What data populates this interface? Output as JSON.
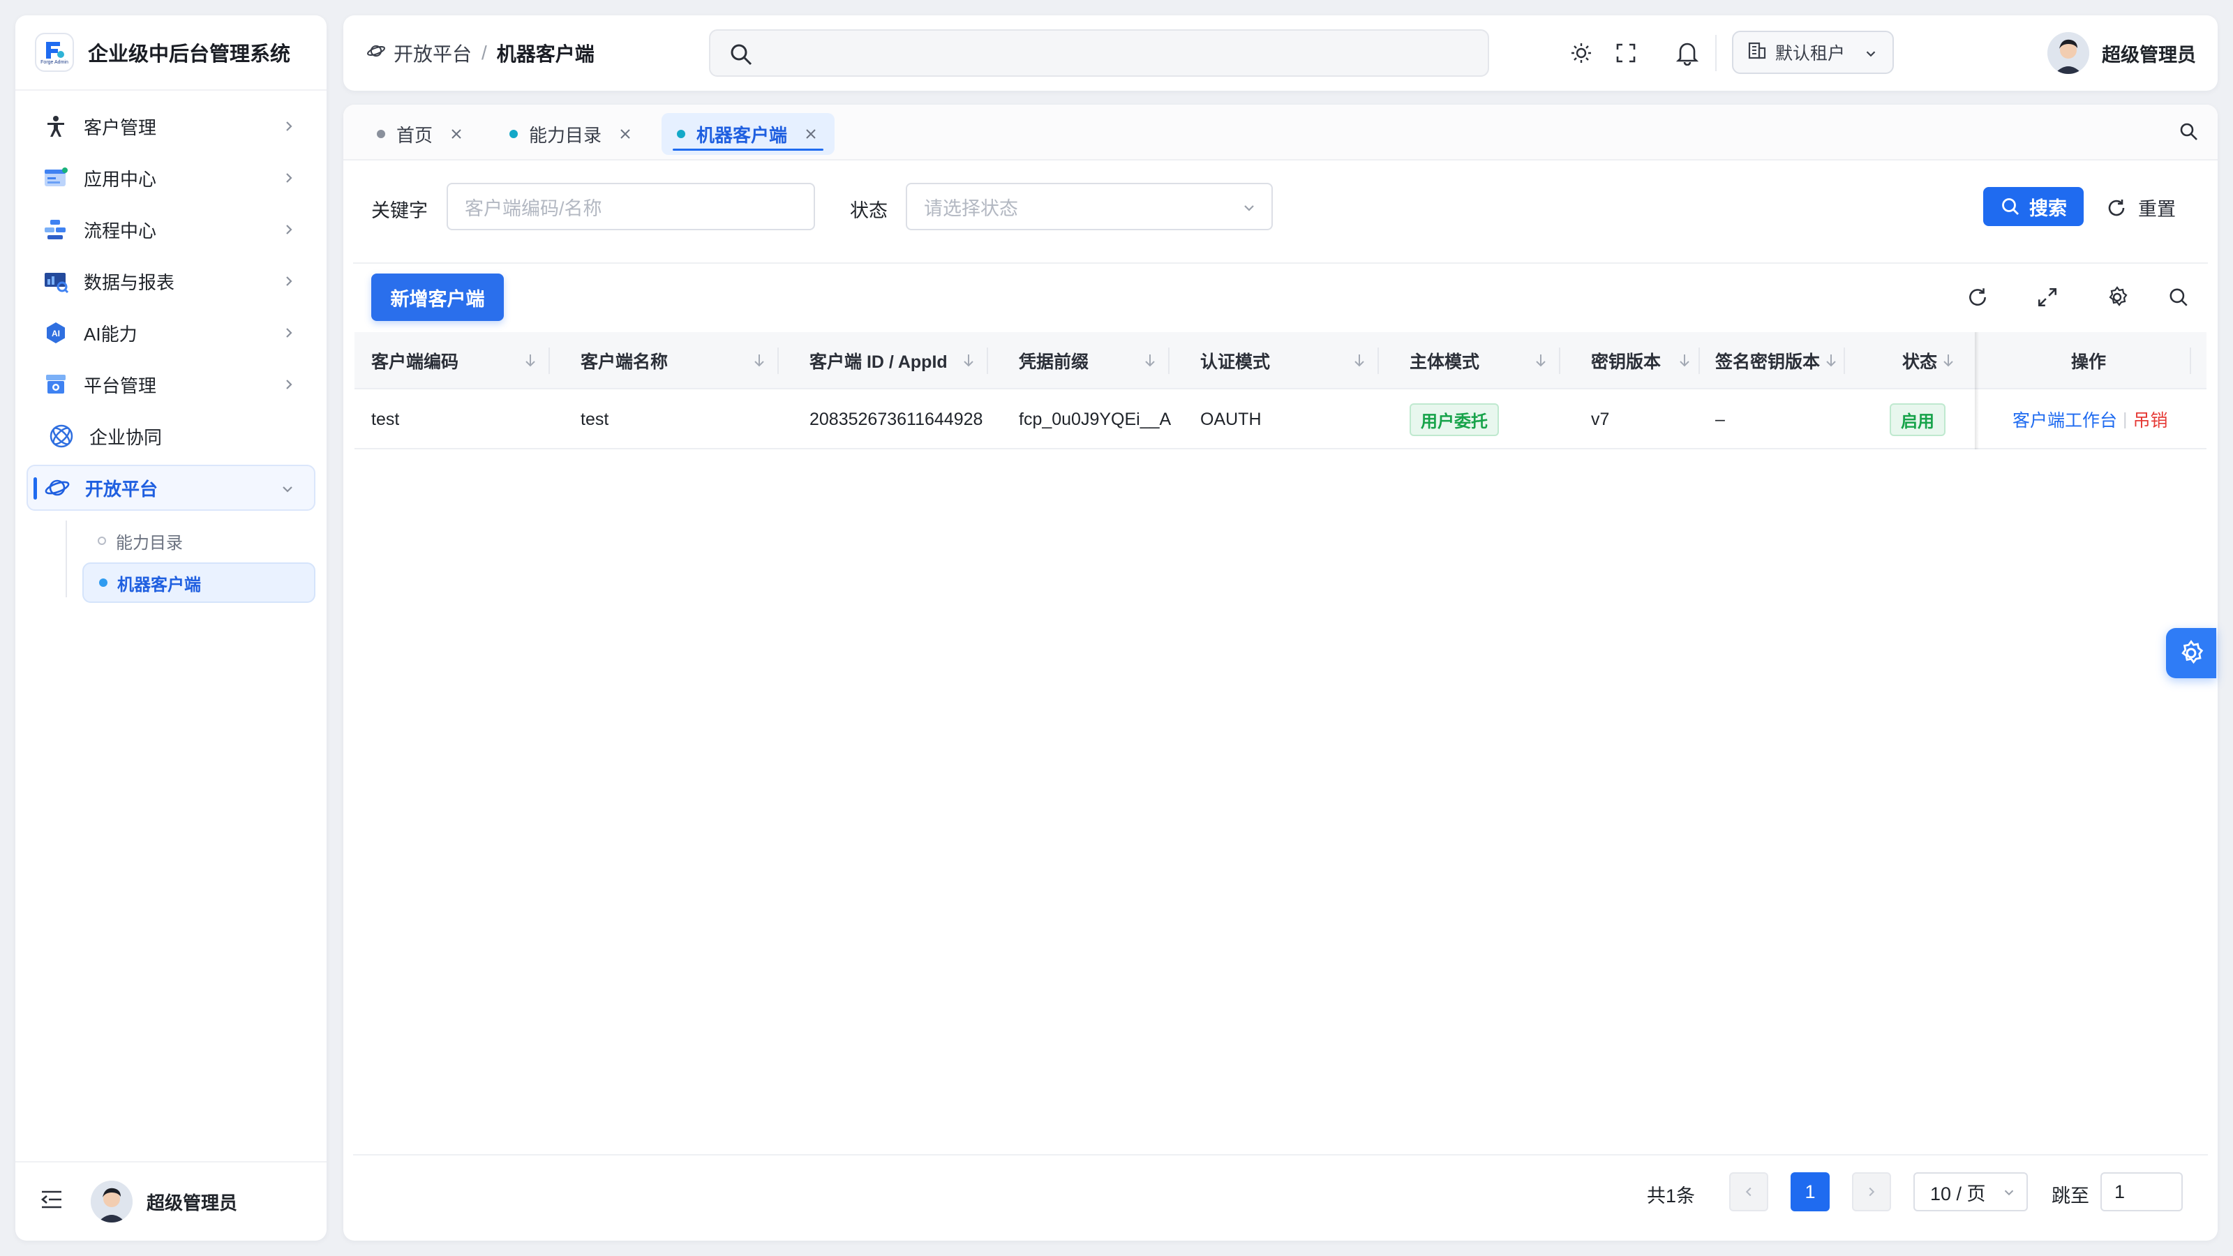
{
  "app": {
    "title": "企业级中后台管理系统",
    "logo_text": "Forge Admin"
  },
  "sidebar": {
    "items": [
      {
        "label": "客户管理",
        "icon": "person-icon"
      },
      {
        "label": "应用中心",
        "icon": "app-window-icon"
      },
      {
        "label": "流程中心",
        "icon": "flow-icon"
      },
      {
        "label": "数据与报表",
        "icon": "report-icon"
      },
      {
        "label": "AI能力",
        "icon": "ai-icon"
      },
      {
        "label": "平台管理",
        "icon": "platform-icon"
      },
      {
        "label": "企业协同",
        "icon": "collab-icon"
      },
      {
        "label": "开放平台",
        "icon": "planet-icon"
      }
    ],
    "open_submenu": [
      {
        "label": "能力目录"
      },
      {
        "label": "机器客户端"
      }
    ],
    "footer_user": "超级管理员"
  },
  "header": {
    "breadcrumb": {
      "first": "开放平台",
      "separator": "/",
      "current": "机器客户端"
    },
    "search_placeholder": "",
    "tenant": "默认租户",
    "user": "超级管理员"
  },
  "tabs": [
    {
      "label": "首页",
      "dot_color": "#8a909c"
    },
    {
      "label": "能力目录",
      "dot_color": "#13a8c8"
    },
    {
      "label": "机器客户端",
      "dot_color": "#13a8c8"
    }
  ],
  "filter": {
    "keyword_label": "关键字",
    "keyword_placeholder": "客户端编码/名称",
    "status_label": "状态",
    "status_placeholder": "请选择状态",
    "search_button": "搜索",
    "reset_button": "重置"
  },
  "toolbar": {
    "add_button": "新增客户端"
  },
  "table": {
    "columns": [
      "客户端编码",
      "客户端名称",
      "客户端 ID / AppId",
      "凭据前缀",
      "认证模式",
      "主体模式",
      "密钥版本",
      "签名密钥版本",
      "状态",
      "操作"
    ],
    "rows": [
      {
        "code": "test",
        "name": "test",
        "app_id": "208352673611644928",
        "prefix": "fcp_0u0J9YQEi__A",
        "auth_mode": "OAUTH",
        "subject_mode": "用户委托",
        "key_version": "v7",
        "sign_key_version": "–",
        "status": "启用",
        "actions": {
          "workbench": "客户端工作台",
          "sep": "|",
          "revoke": "吊销"
        }
      }
    ]
  },
  "pagination": {
    "total": "共1条",
    "current_page": "1",
    "page_size": "10 / 页",
    "jump_label": "跳至",
    "jump_value": "1"
  },
  "colors": {
    "accent": "#1f6bf0",
    "danger": "#e53935",
    "success": "#17a34a"
  }
}
